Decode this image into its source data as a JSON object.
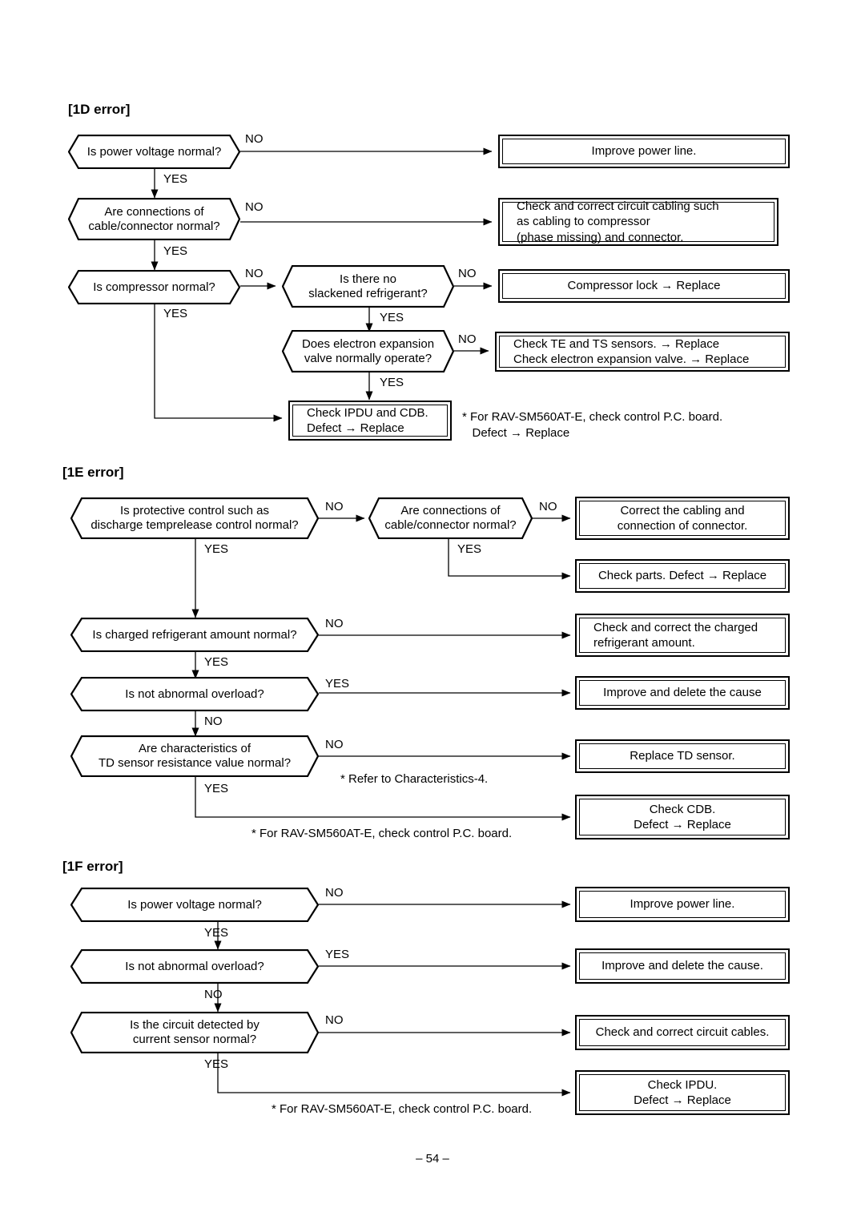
{
  "page": {
    "number": "– 54 –"
  },
  "sections": [
    {
      "id": "1d",
      "title": "[1D error]",
      "decisions": [
        {
          "name": "is-power-voltage-normal",
          "text": "Is power voltage normal?"
        },
        {
          "name": "are-connections-of-cable-connector-normal",
          "line1": "Are connections of",
          "line2": "cable/connector normal?"
        },
        {
          "name": "is-compressor-normal",
          "text": "Is compressor normal?"
        },
        {
          "name": "is-there-no-slackened-refrigerant",
          "line1": "Is there no",
          "line2": "slackened refrigerant?"
        },
        {
          "name": "does-electron-expansion-valve-normally-operate",
          "line1": "Does electron expansion",
          "line2": "valve normally operate?"
        }
      ],
      "actions": [
        {
          "name": "improve-power-line",
          "text": "Improve power line."
        },
        {
          "name": "check-and-correct-circuit-cabling",
          "line1": "Check and correct circuit cabling such",
          "line2": "as cabling to compressor",
          "line3": "(phase missing) and connector."
        },
        {
          "name": "compressor-lock-replace",
          "text": "Compressor lock → Replace"
        },
        {
          "name": "check-te-ts-sensors",
          "line1": "Check TE and TS sensors. → Replace",
          "line2": "Check electron expansion valve. → Replace"
        },
        {
          "name": "check-ipdu-and-cdb",
          "line1": "Check IPDU and CDB.",
          "line2": "Defect → Replace"
        }
      ],
      "branch_labels": {
        "no": "NO",
        "yes": "YES"
      },
      "note": {
        "name": "note-rav-sm560at-e",
        "line1": "* For RAV-SM560AT-E, check control P.C. board.",
        "line2": "   Defect → Replace"
      }
    },
    {
      "id": "1e",
      "title": "[1E error]",
      "decisions": [
        {
          "name": "is-protective-control-normal",
          "line1": "Is protective control such as",
          "line2": "discharge temprelease control normal?"
        },
        {
          "name": "are-connections-of-cable-connector-normal",
          "line1": "Are connections of",
          "line2": "cable/connector normal?"
        },
        {
          "name": "is-charged-refrigerant-amount-normal",
          "text": "Is charged refrigerant amount normal?"
        },
        {
          "name": "is-not-abnormal-overload",
          "text": "Is not abnormal overload?"
        },
        {
          "name": "are-characteristics-of-td-sensor-resistance-normal",
          "line1": "Are characteristics of",
          "line2": "TD sensor resistance value normal?"
        }
      ],
      "actions": [
        {
          "name": "correct-the-cabling-and-connection",
          "line1": "Correct the cabling and",
          "line2": "connection of connector."
        },
        {
          "name": "check-parts-defect-replace",
          "text": "Check parts. Defect → Replace"
        },
        {
          "name": "check-and-correct-charged-refrigerant",
          "line1": "Check and correct the charged",
          "line2": "refrigerant amount."
        },
        {
          "name": "improve-and-delete-the-cause",
          "text": "Improve and delete the cause"
        },
        {
          "name": "replace-td-sensor",
          "text": "Replace TD sensor."
        },
        {
          "name": "check-cdb-defect-replace",
          "line1": "Check CDB.",
          "line2": "Defect → Replace"
        }
      ],
      "branch_labels": {
        "no": "NO",
        "yes": "YES"
      },
      "note_characteristics": {
        "name": "note-refer-characteristics-4",
        "text": "* Refer to Characteristics-4."
      },
      "note_rav": {
        "name": "note-rav-sm560at-e",
        "text": "* For RAV-SM560AT-E, check control P.C. board."
      }
    },
    {
      "id": "1f",
      "title": "[1F error]",
      "decisions": [
        {
          "name": "is-power-voltage-normal",
          "text": "Is power voltage normal?"
        },
        {
          "name": "is-not-abnormal-overload",
          "text": "Is not abnormal overload?"
        },
        {
          "name": "is-the-circuit-detected-by-current-sensor-normal",
          "line1": "Is the circuit detected by",
          "line2": "current sensor normal?"
        }
      ],
      "actions": [
        {
          "name": "improve-power-line",
          "text": "Improve power line."
        },
        {
          "name": "improve-and-delete-the-cause",
          "text": "Improve and delete the cause."
        },
        {
          "name": "check-and-correct-circuit-cables",
          "text": "Check and correct circuit cables."
        },
        {
          "name": "check-ipdu-defect-replace",
          "line1": "Check IPDU.",
          "line2": "Defect → Replace"
        }
      ],
      "branch_labels": {
        "no": "NO",
        "yes": "YES"
      },
      "note_rav": {
        "name": "note-rav-sm560at-e",
        "text": "* For RAV-SM560AT-E, check control P.C. board."
      }
    }
  ]
}
